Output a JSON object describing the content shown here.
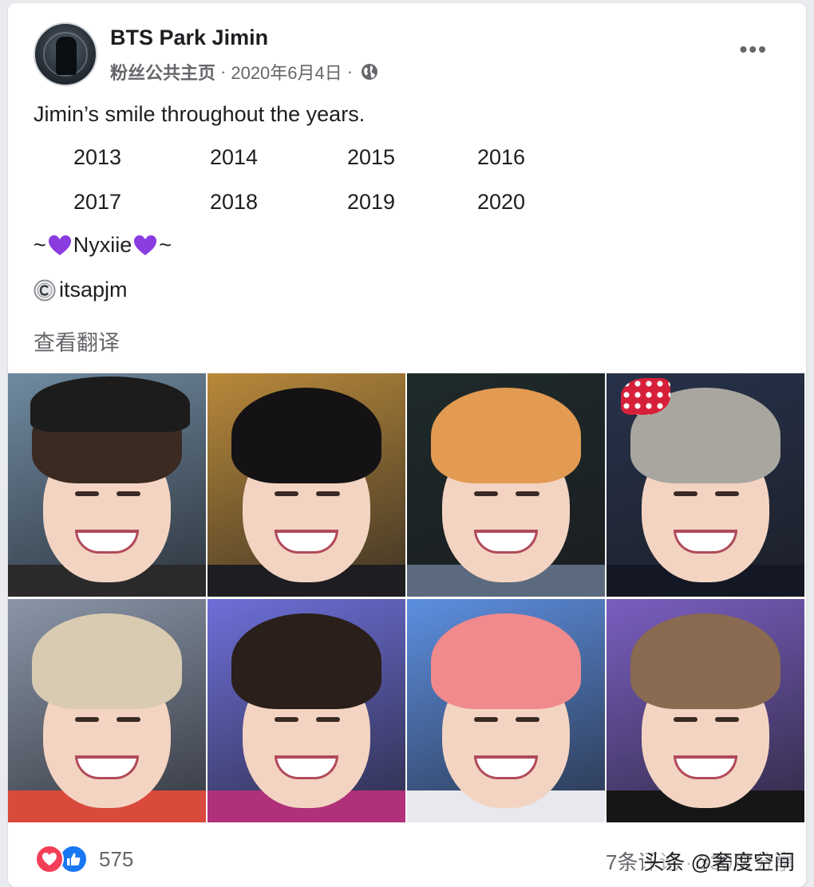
{
  "post": {
    "page_name": "BTS Park Jimin",
    "page_type": "粉丝公共主页",
    "date": "2020年6月4日",
    "separator": "·",
    "more_label": "•••",
    "text": "Jimin’s smile throughout the years.",
    "years_row1": [
      "2013",
      "2014",
      "2015",
      "2016"
    ],
    "years_row2": [
      "2017",
      "2018",
      "2019",
      "2020"
    ],
    "signature_prefix": "~",
    "signature_name": "Nyxiie",
    "signature_suffix": "~",
    "credit": "itsapjm",
    "translate_label": "查看翻译"
  },
  "photos": [
    {
      "year": "2013",
      "hair": "#3b2a22",
      "bg": "#6f8aa0",
      "body": "#2a2a2a",
      "cap": true
    },
    {
      "year": "2014",
      "hair": "#141214",
      "bg": "#b8893a",
      "body": "#1e1e22"
    },
    {
      "year": "2015",
      "hair": "#e39a52",
      "bg": "#1e2a2a",
      "body": "#5b6a7e"
    },
    {
      "year": "2016",
      "hair": "#a9a6a0",
      "bg": "#26324a",
      "body": "#141824",
      "bow": true
    },
    {
      "year": "2017",
      "hair": "#d9cbb2",
      "bg": "#8a96a8",
      "body": "#d94a3c"
    },
    {
      "year": "2018",
      "hair": "#2a1f1a",
      "bg": "#6d6fd8",
      "body": "#b0307a"
    },
    {
      "year": "2019",
      "hair": "#f08a8c",
      "bg": "#5d8fe0",
      "body": "#e8e8ee"
    },
    {
      "year": "2020",
      "hair": "#8a6a50",
      "bg": "#7a5ec0",
      "body": "#161616"
    }
  ],
  "footer": {
    "reaction_count": "575",
    "stats_text": "7条评论 · 330次分享",
    "watermark": "头条 @奢度空间"
  },
  "colors": {
    "love": "#f33e58",
    "like": "#1877f2",
    "heart_purple": "#8a3ce0",
    "secondary_text": "#65676b"
  },
  "icons": [
    "globe-icon",
    "more-options-icon",
    "purple-heart-icon",
    "copyright-icon",
    "love-reaction-icon",
    "like-reaction-icon"
  ]
}
